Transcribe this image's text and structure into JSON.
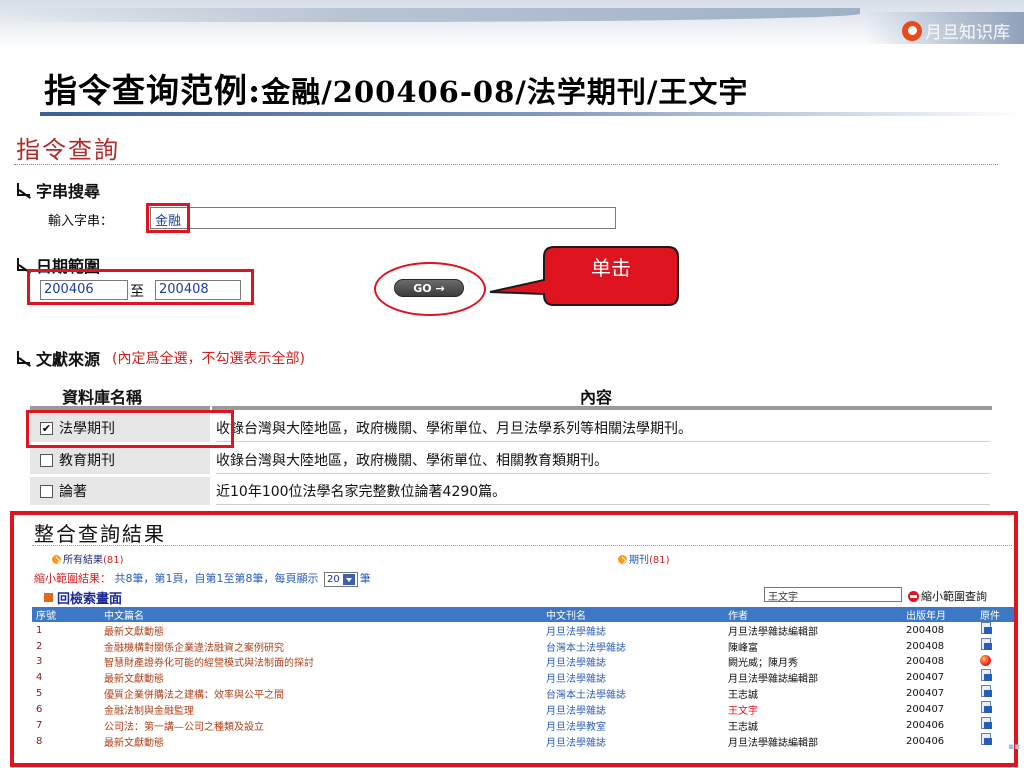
{
  "logo": {
    "icon": "logo-mark-icon",
    "text": "月旦知识库"
  },
  "slide_title": {
    "prefix": "指令查询范例:",
    "query": "金融/200406-08/法学期刊/王文宇"
  },
  "section_heading": "指令查詢",
  "string_search": {
    "heading": "字串搜尋",
    "label": "輸入字串：",
    "value": "金融"
  },
  "date_range": {
    "heading": "日期範圍",
    "from": "200406",
    "separator": "至",
    "to": "200408",
    "go_label": "GO →"
  },
  "callout": "单击",
  "sources": {
    "heading": "文獻來源",
    "note": "(內定爲全選，不勾選表示全部)",
    "col_name": "資料庫名稱",
    "col_content": "內容",
    "rows": [
      {
        "name": "法學期刊",
        "checked": true,
        "desc": "收錄台灣與大陸地區，政府機關、學術單位、月旦法學系列等相關法學期刊。"
      },
      {
        "name": "教育期刊",
        "checked": false,
        "desc": "收錄台灣與大陸地區，政府機關、學術單位、相關教育類期刊。"
      },
      {
        "name": "論著",
        "checked": false,
        "desc": "近10年100位法學名家完整數位論著4290篇。"
      }
    ]
  },
  "results": {
    "title": "整合查詢結果",
    "all_results": "所有結果",
    "all_count": "(81)",
    "periodical": "期刊",
    "periodical_count": "(81)",
    "narrow_prefix": "縮小範圍結果：",
    "narrow_info": "共8筆，第1頁，自第1至第8筆，每頁顯示",
    "page_size": "20",
    "narrow_suffix": "筆",
    "back_label": "回檢索畫面",
    "narrow_input": "王文宇",
    "narrow_button": "縮小範圍查詢",
    "columns": [
      "序號",
      "中文篇名",
      "中文刊名",
      "作者",
      "出版年月",
      "原件"
    ],
    "rows": [
      {
        "no": "1",
        "title": "最新文獻動態",
        "journal": "月旦法學雜誌",
        "author": "月旦法學雜誌編輯部",
        "author_red": false,
        "date": "200408",
        "icon": "document-icon"
      },
      {
        "no": "2",
        "title": "金融機構對關係企業違法融資之案例研究",
        "journal": "台灣本土法學雜誌",
        "author": "陳峰富",
        "author_red": false,
        "date": "200408",
        "icon": "document-icon"
      },
      {
        "no": "3",
        "title": "智慧財產證券化可能的經營模式與法制面的探討",
        "journal": "月旦法學雜誌",
        "author": "闕光威；陳月秀",
        "author_red": false,
        "date": "200408",
        "icon": "media-orb-icon"
      },
      {
        "no": "4",
        "title": "最新文獻動態",
        "journal": "月旦法學雜誌",
        "author": "月旦法學雜誌編輯部",
        "author_red": false,
        "date": "200407",
        "icon": "document-icon"
      },
      {
        "no": "5",
        "title": "優質企業併購法之建構：效率與公平之間",
        "journal": "台灣本土法學雜誌",
        "author": "王志誠",
        "author_red": false,
        "date": "200407",
        "icon": "document-icon"
      },
      {
        "no": "6",
        "title": "金融法制與金融監理",
        "journal": "月旦法學雜誌",
        "author": "王文宇",
        "author_red": true,
        "date": "200407",
        "icon": "document-icon"
      },
      {
        "no": "7",
        "title": "公司法：第一講—公司之種類及設立",
        "journal": "月旦法學教室",
        "author": "王志誠",
        "author_red": false,
        "date": "200406",
        "icon": "document-icon"
      },
      {
        "no": "8",
        "title": "最新文獻動態",
        "journal": "月旦法學雜誌",
        "author": "月旦法學雜誌編輯部",
        "author_red": false,
        "date": "200406",
        "icon": "document-icon"
      }
    ]
  },
  "colors": {
    "highlight_red": "#e0141e",
    "header_blue": "#3d78c6",
    "heading_red": "#b32a2a"
  }
}
